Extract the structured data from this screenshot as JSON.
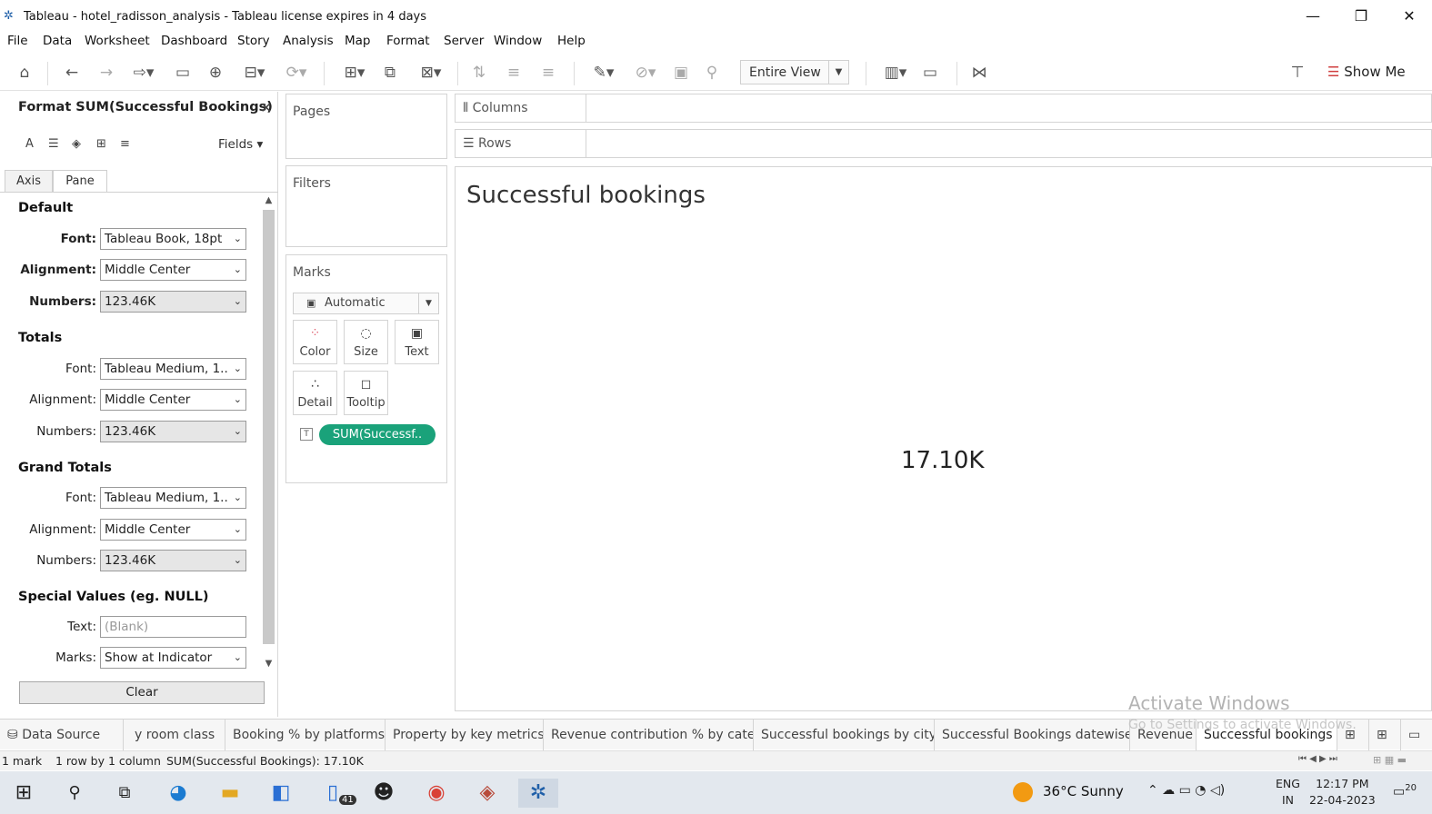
{
  "window": {
    "title": "Tableau - hotel_radisson_analysis - Tableau license expires in 4 days"
  },
  "menu": [
    "File",
    "Data",
    "Worksheet",
    "Dashboard",
    "Story",
    "Analysis",
    "Map",
    "Format",
    "Server",
    "Window",
    "Help"
  ],
  "toolbar": {
    "view_mode": "Entire View",
    "show_me": "Show Me"
  },
  "format_pane": {
    "title": "Format SUM(Successful Bookings)",
    "fields_label": "Fields",
    "tabs": [
      "Axis",
      "Pane"
    ],
    "active_tab": "Pane",
    "sections": {
      "default": {
        "heading": "Default",
        "font_label": "Font:",
        "font": "Tableau Book, 18pt",
        "alignment_label": "Alignment:",
        "alignment": "Middle Center",
        "numbers_label": "Numbers:",
        "numbers": "123.46K"
      },
      "totals": {
        "heading": "Totals",
        "font_label": "Font:",
        "font": "Tableau Medium, 1..",
        "alignment_label": "Alignment:",
        "alignment": "Middle Center",
        "numbers_label": "Numbers:",
        "numbers": "123.46K"
      },
      "grand_totals": {
        "heading": "Grand Totals",
        "font_label": "Font:",
        "font": "Tableau Medium, 1..",
        "alignment_label": "Alignment:",
        "alignment": "Middle Center",
        "numbers_label": "Numbers:",
        "numbers": "123.46K"
      },
      "special": {
        "heading": "Special Values (eg. NULL)",
        "text_label": "Text:",
        "text_placeholder": "(Blank)",
        "marks_label": "Marks:",
        "marks": "Show at Indicator"
      }
    },
    "clear_label": "Clear"
  },
  "cards": {
    "pages": "Pages",
    "filters": "Filters",
    "marks": "Marks",
    "columns": "Columns",
    "rows": "Rows"
  },
  "marks": {
    "type": "Automatic",
    "buttons": [
      "Color",
      "Size",
      "Text",
      "Detail",
      "Tooltip"
    ],
    "pill": "SUM(Successf.."
  },
  "viz": {
    "title": "Successful bookings",
    "value": "17.10K"
  },
  "watermark": {
    "line1": "Activate Windows",
    "line2": "Go to Settings to activate Windows."
  },
  "sheet_tabs": {
    "data_source": "Data Source",
    "tabs": [
      "y room class",
      "Booking % by platforms",
      "Property by key metrics",
      "Revenue contribution % by cate...",
      "Successful bookings by city",
      "Successful Bookings datewise",
      "Revenue",
      "Successful bookings"
    ],
    "active": "Successful bookings"
  },
  "status": {
    "marks": "1 mark",
    "dims": "1 row by 1 column",
    "sum": "SUM(Successful Bookings): 17.10K"
  },
  "taskbar": {
    "badge": "41",
    "weather": "36°C  Sunny",
    "lang1": "ENG",
    "lang2": "IN",
    "time": "12:17 PM",
    "date": "22-04-2023",
    "notif_count": "20"
  },
  "colors": {
    "pill": "#1aa27a",
    "accent": "#1f5fa8"
  },
  "icons": [
    "home-icon",
    "undo-icon",
    "redo-icon",
    "save-icon",
    "new-datasource-icon",
    "swap-icon",
    "sort-icon",
    "highlight-icon",
    "presentation-icon",
    "share-icon",
    "format-painter-icon",
    "show-me-icon"
  ]
}
